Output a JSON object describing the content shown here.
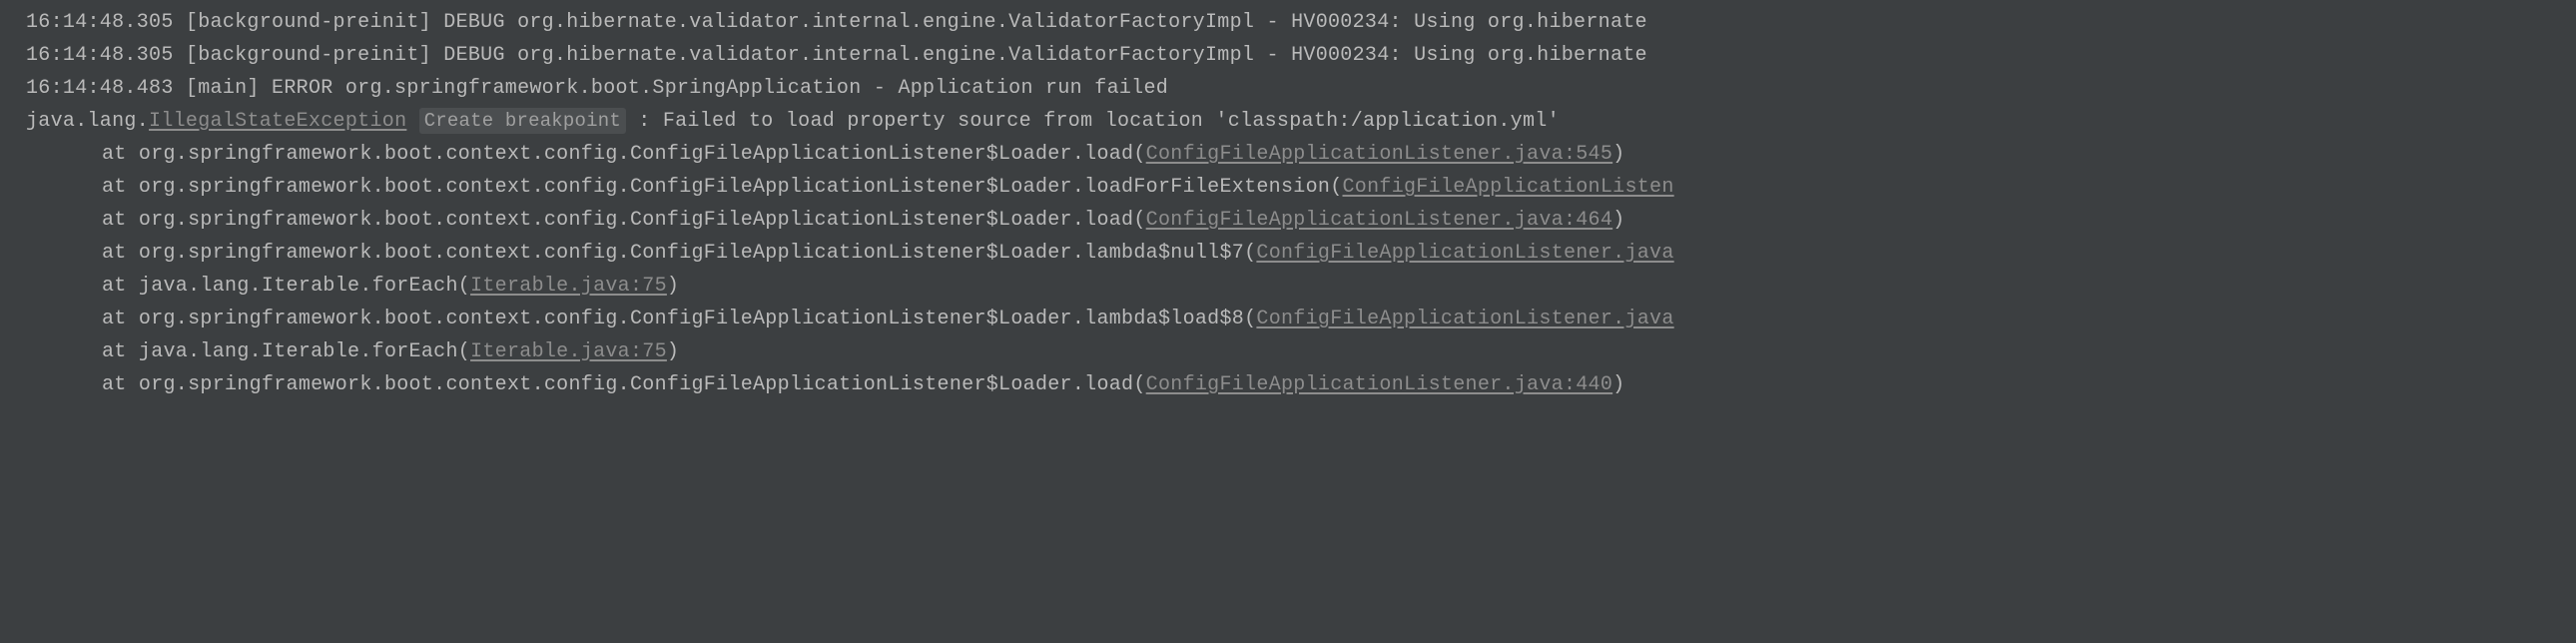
{
  "lines": {
    "l0": {
      "text": "16:14:48.305 [background-preinit] DEBUG org.hibernate.validator.internal.engine.ValidatorFactoryImpl - HV000234: Using org.hibernate"
    },
    "l1": {
      "text": "16:14:48.305 [background-preinit] DEBUG org.hibernate.validator.internal.engine.ValidatorFactoryImpl - HV000234: Using org.hibernate"
    },
    "l2": {
      "text": "16:14:48.483 [main] ERROR org.springframework.boot.SpringApplication - Application run failed"
    },
    "l3": {
      "prefix": "java.lang.",
      "exception_link": "IllegalStateException",
      "create_bp_label": "Create breakpoint",
      "suffix": " : Failed to load property source from location 'classpath:/application.yml'"
    },
    "l4": {
      "prefix": "at org.springframework.boot.context.config.ConfigFileApplicationListener$Loader.load(",
      "link": "ConfigFileApplicationListener.java:545",
      "suffix": ")"
    },
    "l5": {
      "prefix": "at org.springframework.boot.context.config.ConfigFileApplicationListener$Loader.loadForFileExtension(",
      "link": "ConfigFileApplicationListen",
      "suffix": ""
    },
    "l6": {
      "prefix": "at org.springframework.boot.context.config.ConfigFileApplicationListener$Loader.load(",
      "link": "ConfigFileApplicationListener.java:464",
      "suffix": ")"
    },
    "l7": {
      "prefix": "at org.springframework.boot.context.config.ConfigFileApplicationListener$Loader.lambda$null$7(",
      "link": "ConfigFileApplicationListener.java",
      "suffix": ""
    },
    "l8": {
      "prefix": "at java.lang.Iterable.forEach(",
      "link": "Iterable.java:75",
      "suffix": ")"
    },
    "l9": {
      "prefix": "at org.springframework.boot.context.config.ConfigFileApplicationListener$Loader.lambda$load$8(",
      "link": "ConfigFileApplicationListener.java",
      "suffix": ""
    },
    "l10": {
      "prefix": "at java.lang.Iterable.forEach(",
      "link": "Iterable.java:75",
      "suffix": ")"
    },
    "l11": {
      "prefix": "at org.springframework.boot.context.config.ConfigFileApplicationListener$Loader.load(",
      "link": "ConfigFileApplicationListener.java:440",
      "suffix": ")"
    }
  }
}
